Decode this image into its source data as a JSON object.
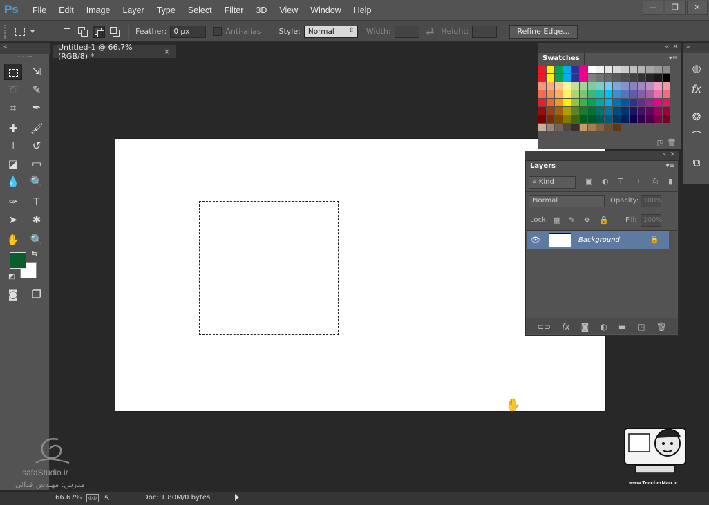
{
  "app": {
    "logo": "Ps"
  },
  "menu": [
    "File",
    "Edit",
    "Image",
    "Layer",
    "Type",
    "Select",
    "Filter",
    "3D",
    "View",
    "Window",
    "Help"
  ],
  "window_controls": [
    "—",
    "❐",
    "✕"
  ],
  "options": {
    "feather_label": "Feather:",
    "feather_value": "0 px",
    "antialias_label": "Anti-alias",
    "style_label": "Style:",
    "style_value": "Normal",
    "width_label": "Width:",
    "height_label": "Height:",
    "refine_button": "Refine Edge..."
  },
  "document": {
    "tab_title": "Untitled-1 @ 66.7% (RGB/8) *",
    "tab_close": "×",
    "canvas_color": "#ffffff"
  },
  "colors": {
    "foreground": "#0c5d2c",
    "background": "#ffffff",
    "accent": "#4aa8e8"
  },
  "swatches": {
    "title": "Swatches",
    "colors": [
      "#ed1c24",
      "#fff200",
      "#00a651",
      "#00aeef",
      "#2e3192",
      "#ec008c",
      "#ffffff",
      "#f2f2f2",
      "#e6e6e6",
      "#d9d9d9",
      "#cccccc",
      "#bfbfbf",
      "#b3b3b3",
      "#a6a6a6",
      "#999999",
      "#8c8c8c",
      "#ed1c24",
      "#fff200",
      "#00a651",
      "#00aeef",
      "#2e3192",
      "#ec008c",
      "#808080",
      "#737373",
      "#666666",
      "#595959",
      "#4d4d4d",
      "#404040",
      "#333333",
      "#262626",
      "#1a1a1a",
      "#000000",
      "#f7977a",
      "#f9ad81",
      "#fdc68a",
      "#fff79a",
      "#c4df9b",
      "#a2d39c",
      "#82ca9d",
      "#7bcdc8",
      "#6ecff6",
      "#7ea7d8",
      "#8493ca",
      "#8882be",
      "#a187be",
      "#bc8dbf",
      "#f49ac2",
      "#f6989d",
      "#f26c4f",
      "#f68e55",
      "#fbaf5c",
      "#fff467",
      "#acd372",
      "#7cc576",
      "#3bb878",
      "#1abbb4",
      "#00bff3",
      "#438cca",
      "#5574b9",
      "#605ca8",
      "#855fa8",
      "#a763a8",
      "#f06ea9",
      "#f26d7d",
      "#ed1c24",
      "#f26522",
      "#f7941d",
      "#fff200",
      "#8dc63f",
      "#39b54a",
      "#00a651",
      "#00a99d",
      "#00aeef",
      "#0072bc",
      "#0054a6",
      "#2e3192",
      "#662d91",
      "#92278f",
      "#ec008c",
      "#ed145b",
      "#9e0b0f",
      "#a0410d",
      "#a36209",
      "#aba000",
      "#598527",
      "#1a7b30",
      "#007236",
      "#00746b",
      "#0076a3",
      "#004b80",
      "#003471",
      "#1b1464",
      "#440e62",
      "#630460",
      "#9e005d",
      "#9e0039",
      "#790000",
      "#7b2e00",
      "#7d4900",
      "#827b00",
      "#406618",
      "#005e20",
      "#005826",
      "#005952",
      "#005b7f",
      "#003663",
      "#002157",
      "#0d004c",
      "#32004b",
      "#4b0049",
      "#7b0046",
      "#7a0026",
      "#c7b299",
      "#998675",
      "#736357",
      "#534741",
      "#37302a",
      "#c69c6d",
      "#a67c52",
      "#8c6239",
      "#754c24",
      "#603913"
    ]
  },
  "layers": {
    "title": "Layers",
    "filter_kind": "Kind",
    "blend_mode": "Normal",
    "opacity_label": "Opacity:",
    "opacity_value": "100%",
    "lock_label": "Lock:",
    "fill_label": "Fill:",
    "fill_value": "100%",
    "items": [
      {
        "name": "Background",
        "locked": true,
        "visible": true
      }
    ]
  },
  "status": {
    "zoom": "66.67%",
    "doc_info": "Doc: 1.80M/0 bytes"
  },
  "watermark": {
    "left_site": "safaStudio.ir",
    "left_name": "مدرس: مهندس فدائی",
    "right_url": "www.TeacherMan.ir"
  }
}
